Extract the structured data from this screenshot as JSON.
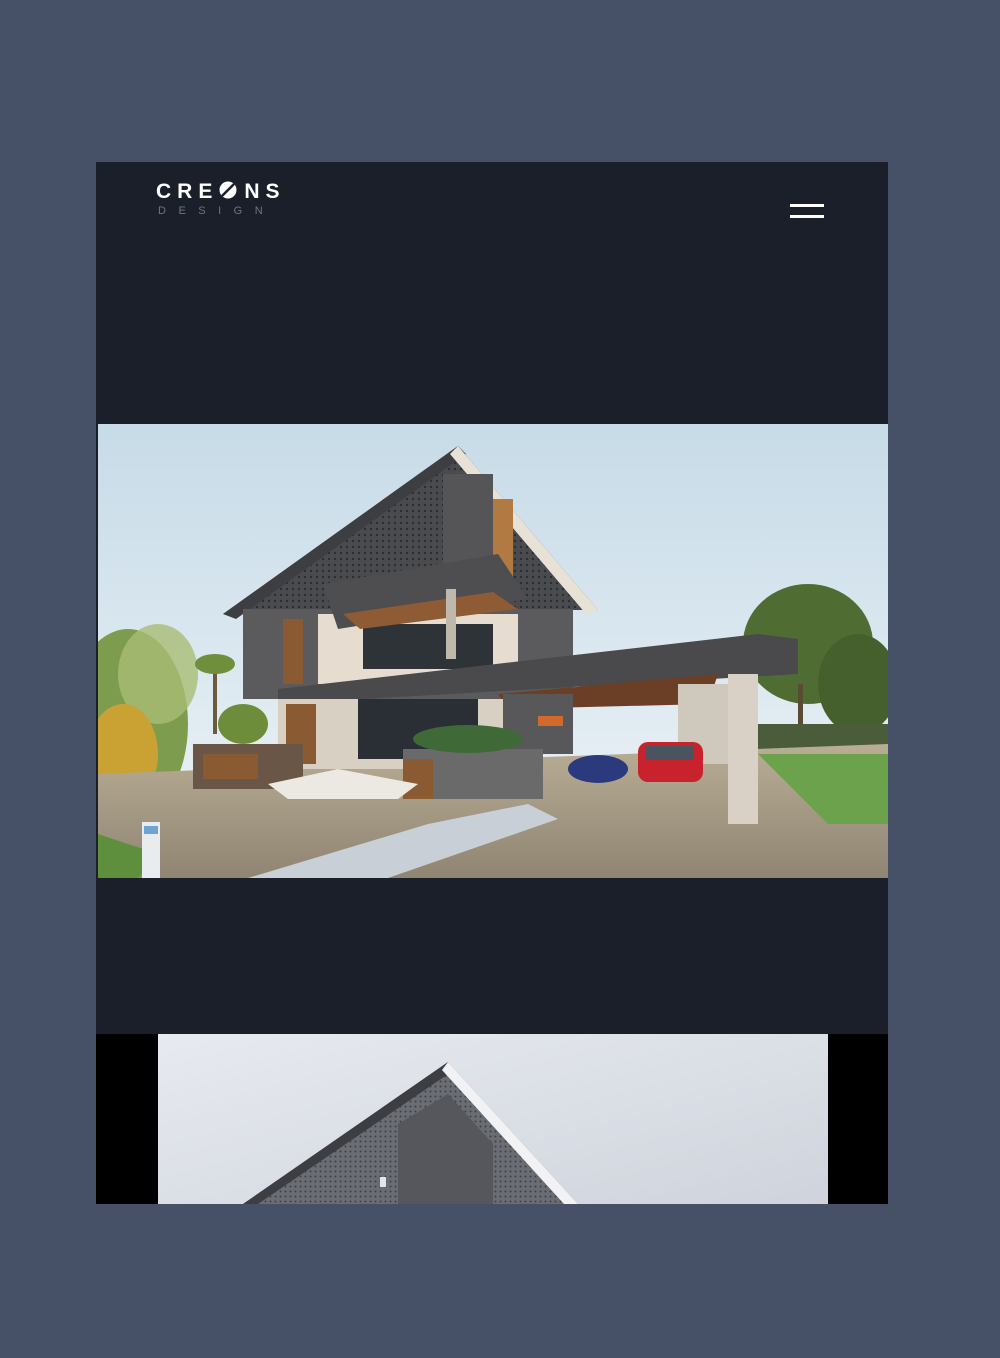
{
  "header": {
    "logo": {
      "name": "CRE",
      "name_end": "NS",
      "tagline": "DESIGN"
    },
    "menu_icon": "hamburger-menu-icon"
  },
  "hero": {
    "image": "modern-house-exterior-render",
    "description_hidden": false
  },
  "gallery": {
    "second_image": "house-roof-monochrome-render"
  },
  "colors": {
    "page_background": "#465066",
    "device_background": "#1b1f29",
    "letterbox": "#000000"
  }
}
